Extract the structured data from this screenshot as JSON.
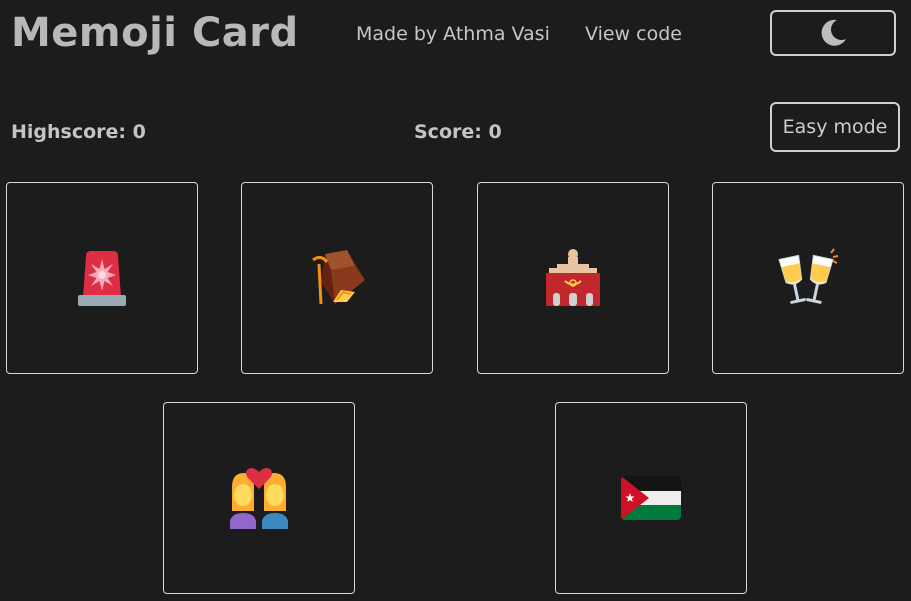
{
  "header": {
    "title": "Memoji Card",
    "made_by": "Made by Athma Vasi",
    "view_code": "View code",
    "theme_icon": "moon-icon"
  },
  "game": {
    "highscore_label": "Highscore: 0",
    "score_label": "Score: 0",
    "mode_button": "Easy mode"
  },
  "cards": [
    {
      "emoji": "police-car-light",
      "icon": "police-light-icon"
    },
    {
      "emoji": "mining-pick",
      "icon": "rock-pick-icon"
    },
    {
      "emoji": "post-office",
      "icon": "post-office-icon"
    },
    {
      "emoji": "clinking-glasses",
      "icon": "clinking-glasses-icon"
    },
    {
      "emoji": "couple-with-heart",
      "icon": "couple-heart-icon"
    },
    {
      "emoji": "flag-jordan",
      "icon": "jordan-flag-icon"
    }
  ]
}
